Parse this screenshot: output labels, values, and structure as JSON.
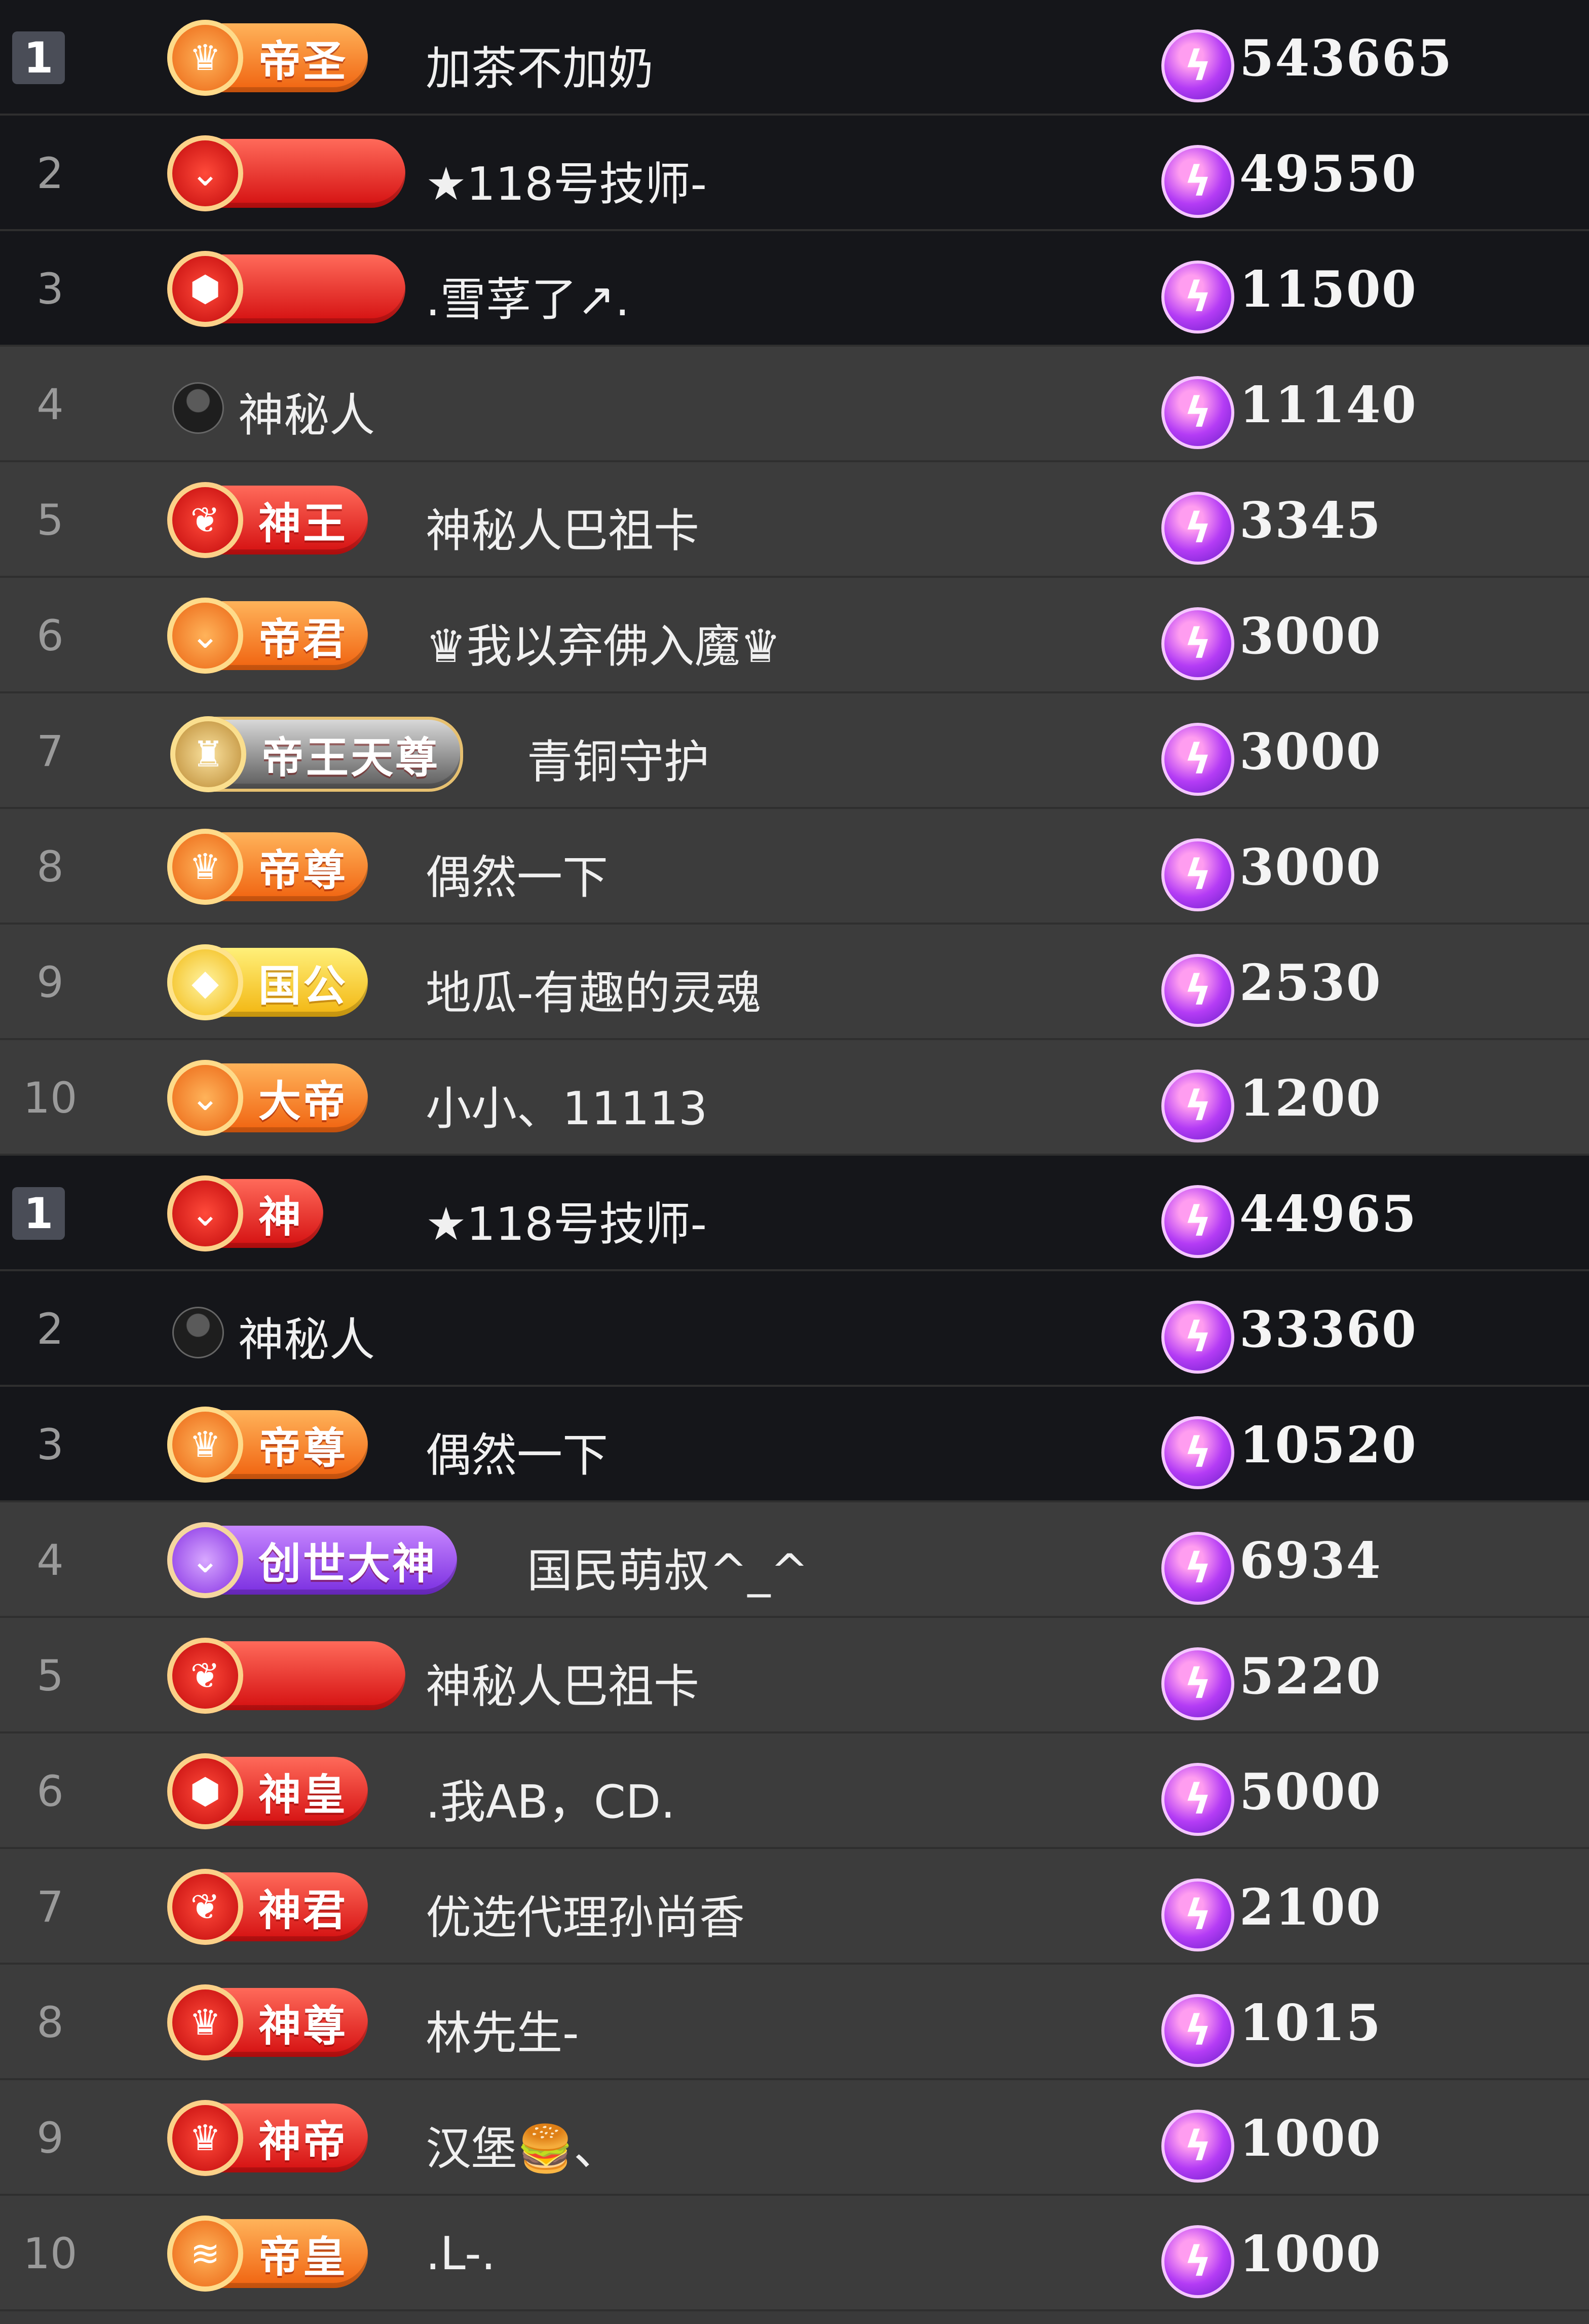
{
  "boards": [
    {
      "rows": [
        {
          "rank": "1",
          "first": true,
          "style": "dark",
          "badge": {
            "text": "帝圣",
            "tone": "orange",
            "emblem": "crown-icon"
          },
          "name": "加茶不加奶",
          "amount": "543665"
        },
        {
          "rank": "2",
          "style": "dark",
          "badge": {
            "text": "",
            "tone": "red",
            "emblem": "chevron-icon"
          },
          "name": "★118号技师-",
          "amount": "49550"
        },
        {
          "rank": "3",
          "style": "dark",
          "badge": {
            "text": "",
            "tone": "red",
            "emblem": "hexagon-icon"
          },
          "name": ".雪莩了↗.",
          "amount": "11500"
        },
        {
          "rank": "4",
          "style": "mid",
          "badge": null,
          "avatar": true,
          "name": "神秘人",
          "amount": "11140"
        },
        {
          "rank": "5",
          "style": "mid",
          "badge": {
            "text": "神王",
            "tone": "red",
            "emblem": "wings-icon"
          },
          "name": "神秘人巴祖卡",
          "amount": "3345"
        },
        {
          "rank": "6",
          "style": "mid",
          "badge": {
            "text": "帝君",
            "tone": "orange",
            "emblem": "chevron-icon"
          },
          "name": "♛我以弃佛入魔♛",
          "amount": "3000"
        },
        {
          "rank": "7",
          "style": "mid",
          "badge": {
            "text": "帝王天尊",
            "tone": "silver",
            "emblem": "crest-icon"
          },
          "name": "青铜守护",
          "amount": "3000"
        },
        {
          "rank": "8",
          "style": "mid",
          "badge": {
            "text": "帝尊",
            "tone": "orange",
            "emblem": "crown-icon"
          },
          "name": "偶然一下",
          "amount": "3000"
        },
        {
          "rank": "9",
          "style": "mid",
          "badge": {
            "text": "国公",
            "tone": "gold",
            "emblem": "diamond-icon"
          },
          "name": "地瓜-有趣的灵魂",
          "amount": "2530"
        },
        {
          "rank": "10",
          "style": "mid",
          "badge": {
            "text": "大帝",
            "tone": "orange",
            "emblem": "chevron-icon"
          },
          "name": "小小、11113",
          "amount": "1200"
        }
      ]
    },
    {
      "rows": [
        {
          "rank": "1",
          "first": true,
          "style": "dark",
          "badge": {
            "text": "神",
            "tone": "red",
            "emblem": "chevron-icon"
          },
          "name": "★118号技师-",
          "amount": "44965"
        },
        {
          "rank": "2",
          "style": "dark",
          "badge": null,
          "avatar": true,
          "name": "神秘人",
          "amount": "33360"
        },
        {
          "rank": "3",
          "style": "dark",
          "badge": {
            "text": "帝尊",
            "tone": "orange",
            "emblem": "crown-icon"
          },
          "name": "偶然一下",
          "amount": "10520"
        },
        {
          "rank": "4",
          "style": "mid",
          "badge": {
            "text": "创世大神",
            "tone": "purple",
            "emblem": "chevron-icon"
          },
          "name": "国民萌叔^_^",
          "amount": "6934"
        },
        {
          "rank": "5",
          "style": "mid",
          "badge": {
            "text": "",
            "tone": "red",
            "emblem": "wings-icon"
          },
          "name": "神秘人巴祖卡",
          "amount": "5220"
        },
        {
          "rank": "6",
          "style": "mid",
          "badge": {
            "text": "神皇",
            "tone": "red",
            "emblem": "hexagon-icon"
          },
          "name": ".我AB，CD.",
          "amount": "5000"
        },
        {
          "rank": "7",
          "style": "mid",
          "badge": {
            "text": "神君",
            "tone": "red",
            "emblem": "wings-icon"
          },
          "name": "优选代理孙尚香",
          "amount": "2100"
        },
        {
          "rank": "8",
          "style": "mid",
          "badge": {
            "text": "神尊",
            "tone": "red",
            "emblem": "crown-icon"
          },
          "name": "林先生-",
          "amount": "1015"
        },
        {
          "rank": "9",
          "style": "mid",
          "badge": {
            "text": "神帝",
            "tone": "red",
            "emblem": "crown-icon"
          },
          "name": "汉堡🍔、",
          "amount": "1000"
        },
        {
          "rank": "10",
          "style": "mid",
          "badge": {
            "text": "帝皇",
            "tone": "orange",
            "emblem": "wifi-icon"
          },
          "name": ".L-.",
          "amount": "1000"
        }
      ]
    }
  ],
  "coin_icon": "lightning-coin-icon",
  "colors": {
    "dark_row": "#15161a",
    "mid_row": "#3c3c3c",
    "coin": "#b43cf5",
    "text": "#f4f4f4"
  }
}
